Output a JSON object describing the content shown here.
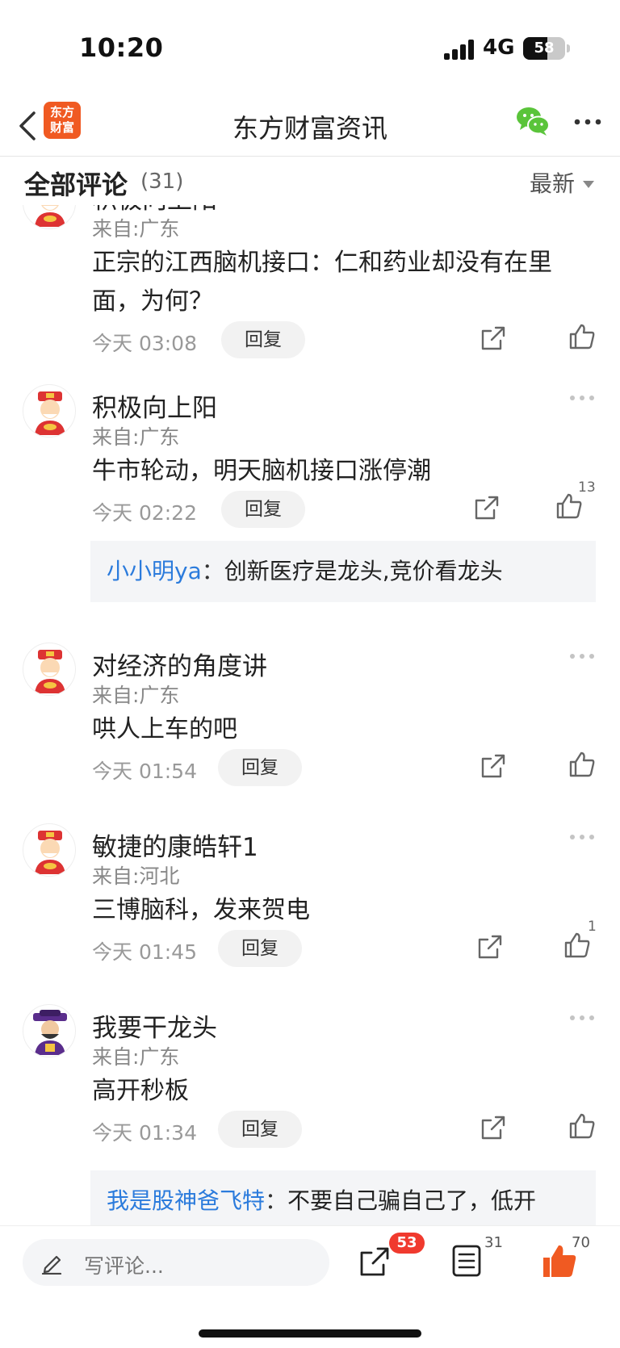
{
  "status": {
    "time": "10:20",
    "network": "4G",
    "battery": "58",
    "battery_level": 0.58
  },
  "nav": {
    "logo_line1": "东方",
    "logo_line2": "财富",
    "title": "东方财富资讯"
  },
  "header": {
    "title": "全部评论",
    "count": "(31)",
    "sort_label": "最新"
  },
  "comments": [
    {
      "username": "积极向上阳",
      "location": "来自:广东",
      "text": "正宗的江西脑机接口：仁和药业却没有在里面，为何？",
      "time": "今天 03:08",
      "reply_label": "回复",
      "likes": ""
    },
    {
      "username": "积极向上阳",
      "location": "来自:广东",
      "text": "牛市轮动，明天脑机接口涨停潮",
      "time": "今天 02:22",
      "reply_label": "回复",
      "likes": "13",
      "sub_reply": {
        "user": "小小明ya",
        "colon": "：",
        "text": "创新医疗是龙头,竞价看龙头"
      }
    },
    {
      "username": "对经济的角度讲",
      "location": "来自:广东",
      "text": "哄人上车的吧",
      "time": "今天 01:54",
      "reply_label": "回复",
      "likes": ""
    },
    {
      "username": "敏捷的康皓轩1",
      "location": "来自:河北",
      "text": "三博脑科，发来贺电",
      "time": "今天 01:45",
      "reply_label": "回复",
      "likes": "1"
    },
    {
      "username": "我要干龙头",
      "location": "来自:广东",
      "text": "高开秒板",
      "time": "今天 01:34",
      "reply_label": "回复",
      "likes": "",
      "sub_reply": {
        "user": "我是股神爸飞特",
        "colon": "：",
        "text": "不要自己骗自己了，低开"
      }
    }
  ],
  "bottom": {
    "input_placeholder": "写评论...",
    "share_count": "53",
    "comment_count": "31",
    "like_count": "70"
  },
  "colors": {
    "accent": "#f05a22",
    "link": "#2b7bdc",
    "badge": "#f03a2e",
    "wechat": "#5ac43a"
  },
  "icons": [
    "back-icon",
    "wechat-icon",
    "more-icon",
    "share-icon",
    "thumb-up-icon",
    "pencil-icon",
    "comment-list-icon"
  ]
}
